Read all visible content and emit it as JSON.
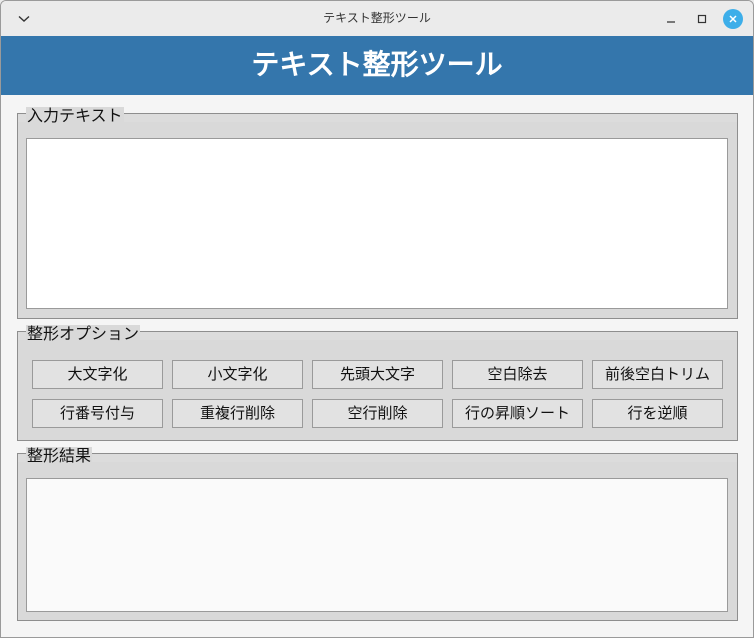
{
  "window": {
    "title": "テキスト整形ツール"
  },
  "header": {
    "title": "テキスト整形ツール"
  },
  "input_section": {
    "legend": "入力テキスト",
    "value": ""
  },
  "options_section": {
    "legend": "整形オプション",
    "buttons": [
      "大文字化",
      "小文字化",
      "先頭大文字",
      "空白除去",
      "前後空白トリム",
      "行番号付与",
      "重複行削除",
      "空行削除",
      "行の昇順ソート",
      "行を逆順"
    ]
  },
  "result_section": {
    "legend": "整形結果",
    "value": ""
  },
  "icons": {
    "menu": "chevron-down-icon",
    "minimize": "minimize-icon",
    "maximize": "maximize-icon",
    "close": "close-icon"
  },
  "colors": {
    "header_bg": "#3476ac",
    "close_button": "#3daee9"
  }
}
